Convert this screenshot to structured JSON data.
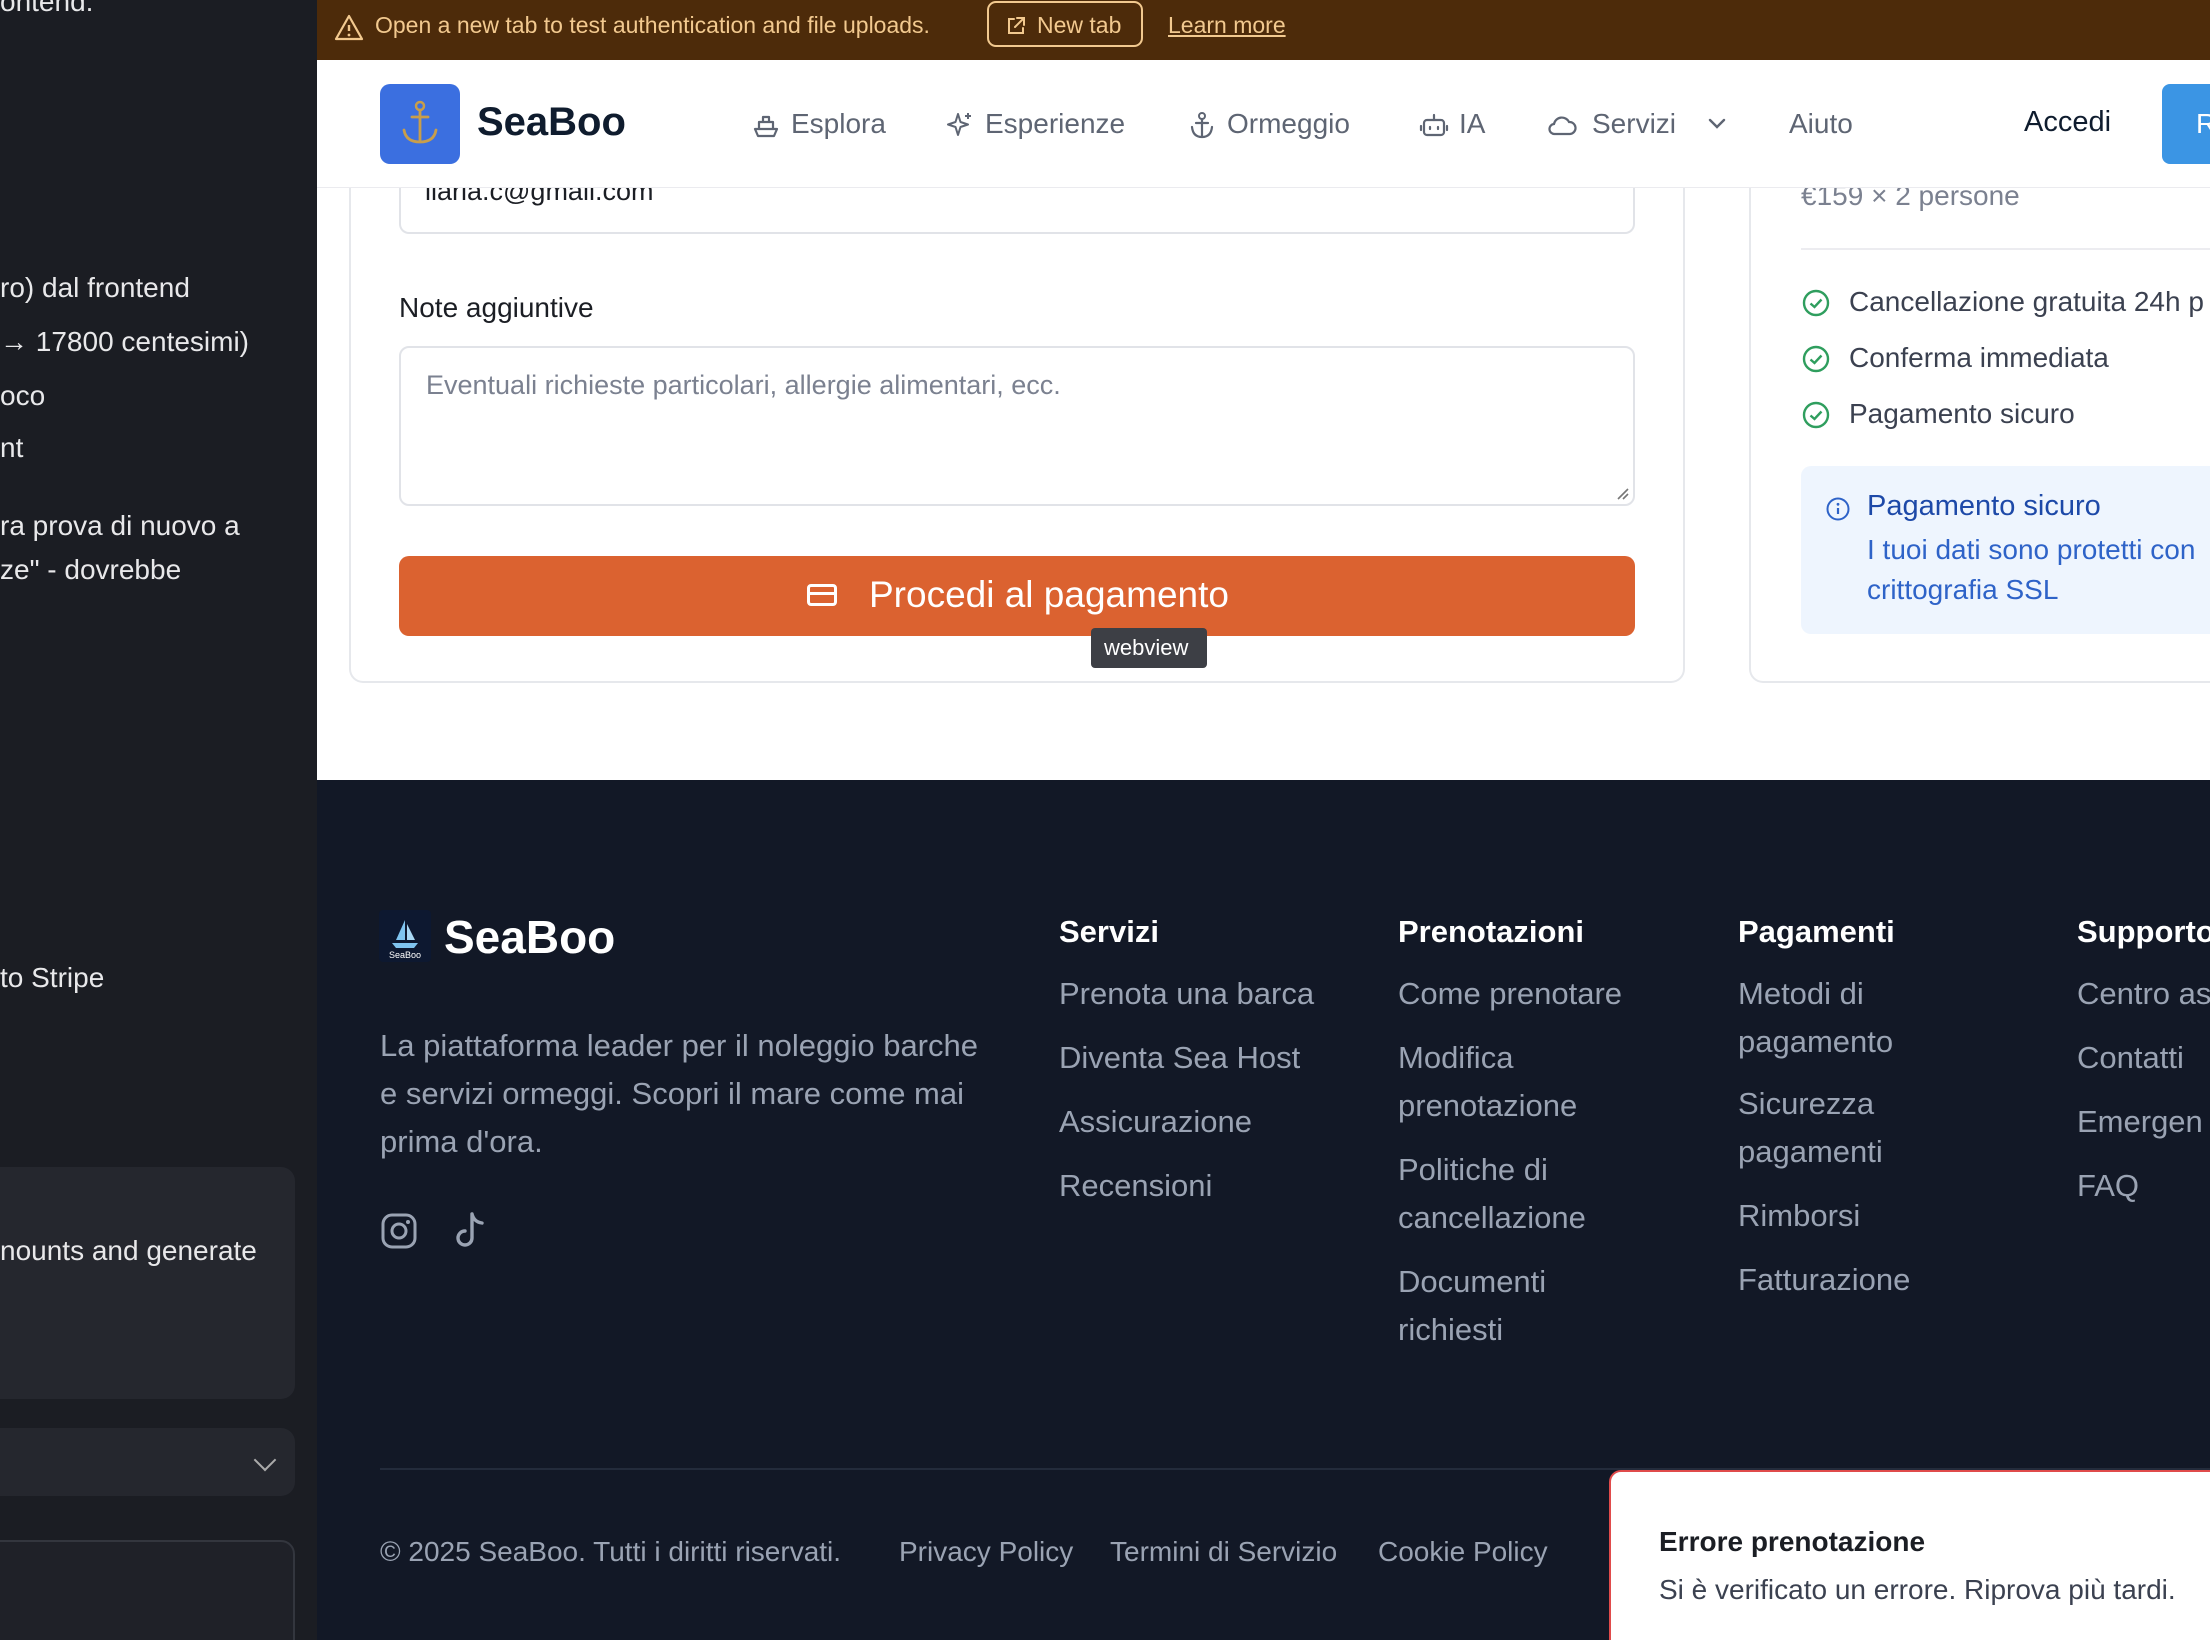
{
  "chat_panel": {
    "lines": [
      "ontend:",
      "ro) dal frontend",
      "→ 17800 centesimi)",
      "oco",
      "nt",
      "ra prova di nuovo a",
      "ze\" - dovrebbe",
      "to Stripe",
      "nounts and generate"
    ]
  },
  "banner": {
    "text": "Open a new tab to test authentication and file uploads.",
    "new_tab": "New tab",
    "learn_more": "Learn more"
  },
  "header": {
    "brand": "SeaBoo",
    "nav": [
      {
        "label": "Esplora",
        "icon": "boat-icon"
      },
      {
        "label": "Esperienze",
        "icon": "sparkles-icon"
      },
      {
        "label": "Ormeggio",
        "icon": "anchor-icon"
      },
      {
        "label": "IA",
        "icon": "robot-icon"
      },
      {
        "label": "Servizi",
        "icon": "cloud-icon"
      },
      {
        "label": "Aiuto",
        "icon": ""
      }
    ],
    "login": "Accedi",
    "register_visible": "R"
  },
  "form": {
    "email_value": "ilaria.c@gmail.com",
    "notes_label": "Note aggiuntive",
    "notes_placeholder": "Eventuali richieste particolari, allergie alimentari, ecc.",
    "pay_button": "Procedi al pagamento",
    "tooltip": "webview"
  },
  "summary": {
    "price_row": "€159 × 2 persone",
    "perks": [
      "Cancellazione gratuita 24h p",
      "Conferma immediata",
      "Pagamento sicuro"
    ],
    "secure_title": "Pagamento sicuro",
    "secure_line1": "I tuoi dati sono protetti con",
    "secure_line2": "crittografia SSL"
  },
  "footer": {
    "brand": "SeaBoo",
    "logo_small": "SeaBoo",
    "description": "La piattaforma leader per il noleggio barche e servizi ormeggi. Scopri il mare come mai prima d'ora.",
    "columns": [
      {
        "title": "Servizi",
        "links": [
          "Prenota una barca",
          "Diventa Sea Host",
          "Assicurazione",
          "Recensioni"
        ]
      },
      {
        "title": "Prenotazioni",
        "links": [
          "Come prenotare",
          "Modifica prenotazione",
          "Politiche di cancellazione",
          "Documenti richiesti"
        ]
      },
      {
        "title": "Pagamenti",
        "links": [
          "Metodi di pagamento",
          "Sicurezza pagamenti",
          "Rimborsi",
          "Fatturazione"
        ]
      },
      {
        "title": "Supporto",
        "links": [
          "Centro as",
          "Contatti",
          "Emergen",
          "FAQ"
        ]
      }
    ],
    "copyright": "© 2025 SeaBoo. Tutti i diritti riservati.",
    "legal": [
      "Privacy Policy",
      "Termini di Servizio",
      "Cookie Policy"
    ]
  },
  "toast": {
    "title": "Errore prenotazione",
    "message": "Si è verificato un errore. Riprova più tardi."
  },
  "colors": {
    "brand_blue": "#3b6fe0",
    "pay_orange": "#db6230",
    "footer_bg": "#121826",
    "banner_bg": "#4d2b0a",
    "success_green": "#2f9e5e",
    "error_red": "#e04b4b"
  }
}
